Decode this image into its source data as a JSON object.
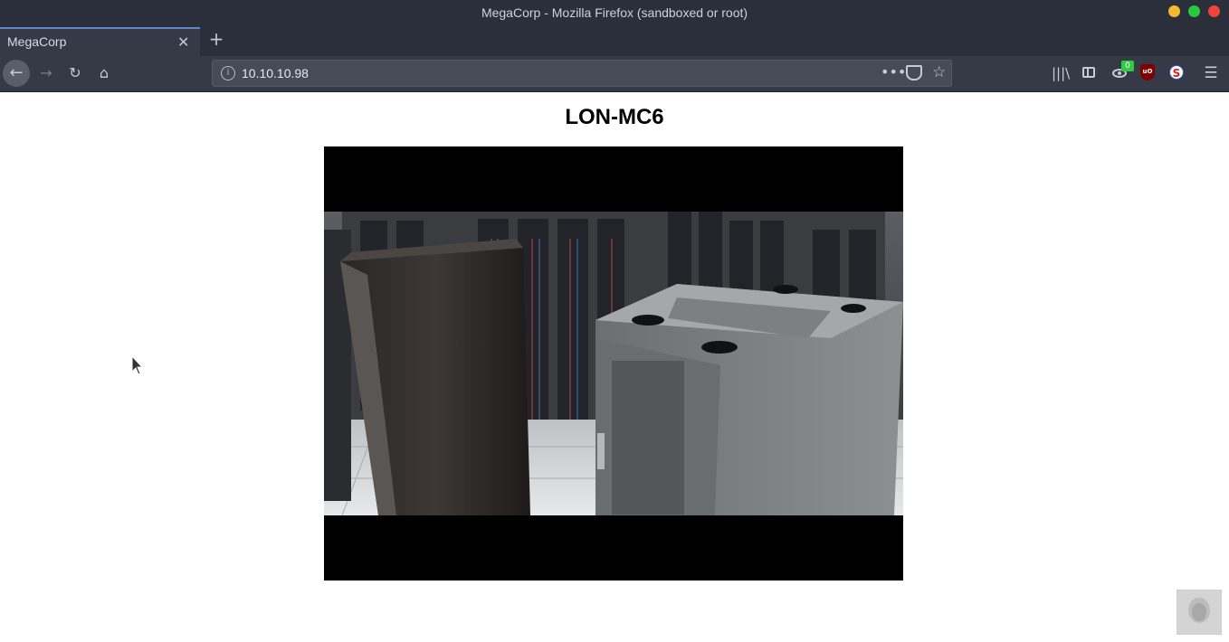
{
  "window": {
    "title": "MegaCorp - Mozilla Firefox (sandboxed or root)"
  },
  "tabs": [
    {
      "label": "MegaCorp",
      "close": "✕"
    }
  ],
  "toolbar": {
    "new_tab": "+",
    "back": "←",
    "forward": "→",
    "reload": "↻",
    "home": "⌂",
    "url": "10.10.10.98",
    "info": "i",
    "more": "•••",
    "star": "☆",
    "library": "|||\\",
    "menu": "☰",
    "extension_badge": "0",
    "ublock_text": "uO",
    "s_ext": "S"
  },
  "page": {
    "heading": "LON-MC6",
    "video_alt": "Server room camera feed"
  },
  "icons": {
    "back": "back-arrow-icon",
    "forward": "forward-arrow-icon",
    "reload": "reload-icon",
    "home": "home-icon",
    "info": "info-icon",
    "more": "more-icon",
    "pocket": "pocket-icon",
    "star": "bookmark-star-icon",
    "library": "library-icon",
    "sidebar": "sidebar-icon",
    "menu": "hamburger-menu-icon"
  },
  "colors": {
    "chrome_bg": "#2b2e3b",
    "toolbar_bg": "#363a47",
    "urlbar_bg": "#474b57",
    "tab_accent": "#5d89c9",
    "minimize": "#f5b82e",
    "maximize": "#27c93f",
    "close": "#f0443b"
  }
}
